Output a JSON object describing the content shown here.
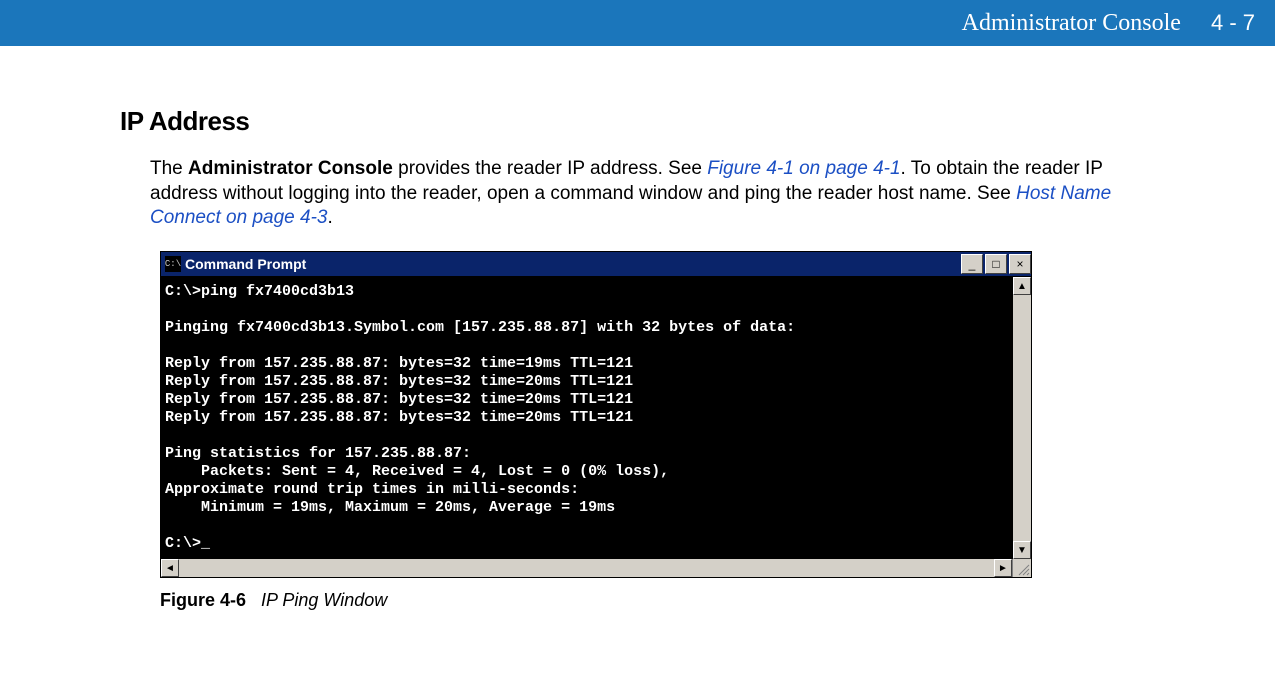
{
  "header": {
    "title": "Administrator Console",
    "page": "4 - 7"
  },
  "section_title": "IP Address",
  "paragraph": {
    "part1": "The ",
    "bold1": "Administrator Console",
    "part2": " provides the reader IP address. See ",
    "link1": "Figure 4-1 on page 4-1",
    "part3": ". To obtain the reader IP address without logging into the reader, open a command window and ping the reader host name. See ",
    "link2": "Host Name Connect on page 4-3",
    "part4": "."
  },
  "cmd": {
    "icon_label": "C:\\",
    "title": "Command Prompt",
    "lines": "C:\\>ping fx7400cd3b13\n\nPinging fx7400cd3b13.Symbol.com [157.235.88.87] with 32 bytes of data:\n\nReply from 157.235.88.87: bytes=32 time=19ms TTL=121\nReply from 157.235.88.87: bytes=32 time=20ms TTL=121\nReply from 157.235.88.87: bytes=32 time=20ms TTL=121\nReply from 157.235.88.87: bytes=32 time=20ms TTL=121\n\nPing statistics for 157.235.88.87:\n    Packets: Sent = 4, Received = 4, Lost = 0 (0% loss),\nApproximate round trip times in milli-seconds:\n    Minimum = 19ms, Maximum = 20ms, Average = 19ms\n\nC:\\>_"
  },
  "figure": {
    "num": "Figure 4-6",
    "caption": "IP Ping Window"
  }
}
